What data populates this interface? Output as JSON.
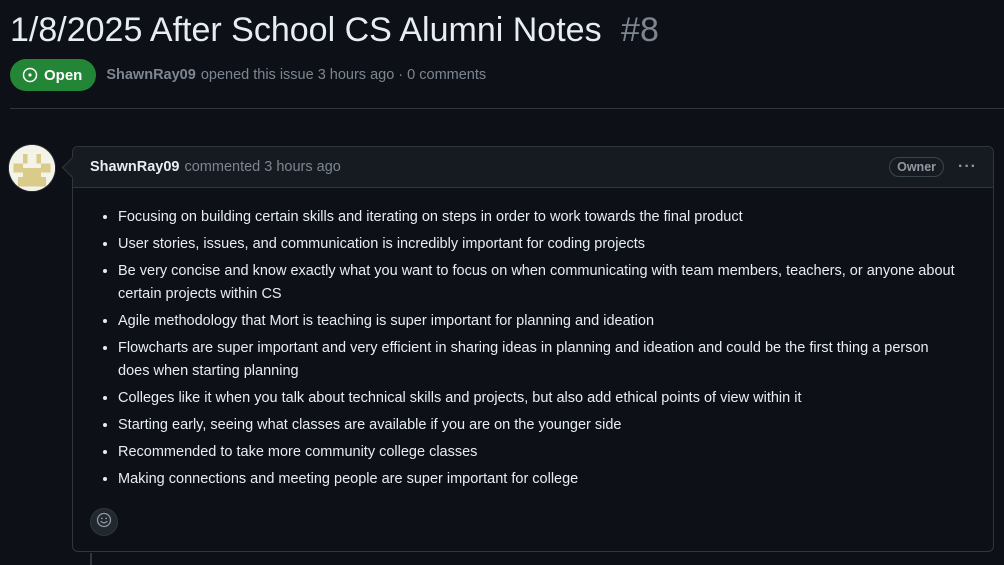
{
  "issue": {
    "title": "1/8/2025 After School CS Alumni Notes",
    "number": "#8",
    "state": "Open",
    "author": "ShawnRay09",
    "meta_text": "opened this issue 3 hours ago · 0 comments"
  },
  "comment": {
    "author": "ShawnRay09",
    "action": "commented 3 hours ago",
    "role_badge": "Owner",
    "menu_icon": "kebab-horizontal-icon",
    "reaction_icon": "smiley-icon",
    "notes": [
      "Focusing on building certain skills and iterating on steps in order to work towards the final product",
      "User stories, issues, and communication is incredibly important for coding projects",
      "Be very concise and know exactly what you want to focus on when communicating with team members, teachers, or anyone about certain projects within CS",
      "Agile methodology that Mort is teaching is super important for planning and ideation",
      "Flowcharts are super important and very efficient in sharing ideas in planning and ideation and could be the first thing a person does when starting planning",
      "Colleges like it when you talk about technical skills and projects, but also add ethical points of view within it",
      "Starting early, seeing what classes are available if you are on the younger side",
      "Recommended to take more community college classes",
      "Making connections and meeting people are super important for college"
    ]
  },
  "colors": {
    "background": "#0d1117",
    "open_badge": "#238636",
    "border": "#30363d",
    "muted_text": "#7d8590"
  }
}
